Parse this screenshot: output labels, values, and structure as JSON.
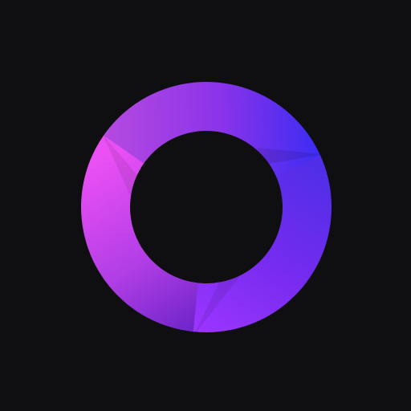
{
  "logo": {
    "icon": "ring-logo-icon",
    "colors": {
      "background": "#0f0f11",
      "magenta": "#e44df0",
      "violet": "#a53ce8",
      "purple": "#7a2cf0",
      "blue": "#3a2cf2"
    }
  }
}
